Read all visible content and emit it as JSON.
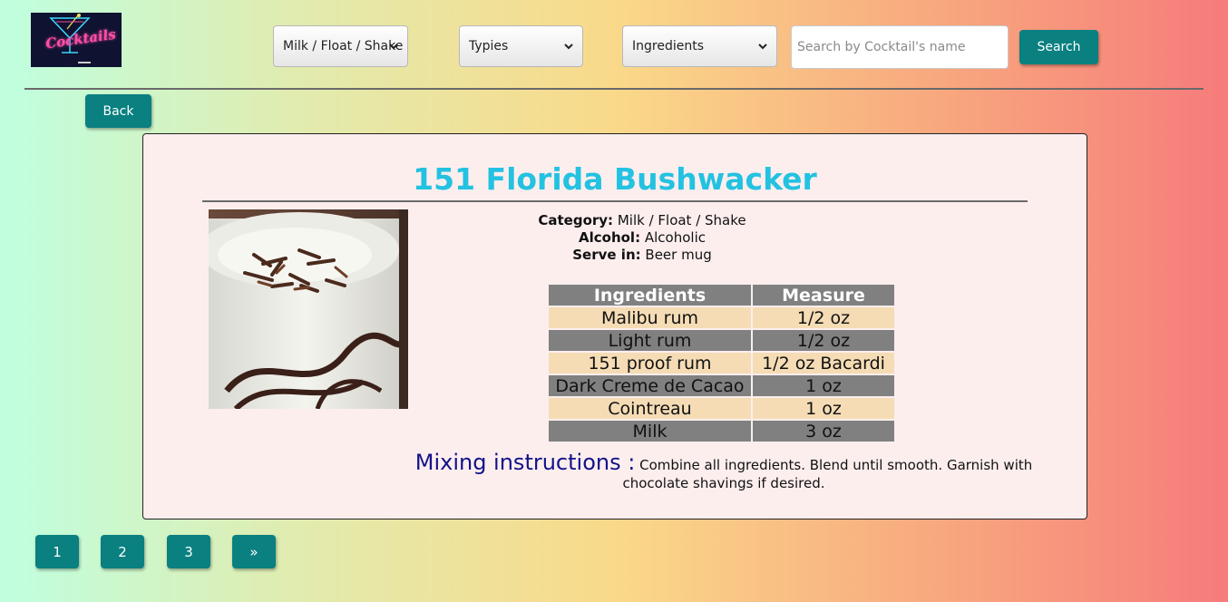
{
  "header": {
    "logo_text": "Cocktails",
    "category_select": {
      "selected": "Milk / Float / Shake"
    },
    "type_select": {
      "selected": "Typies"
    },
    "ingredient_select": {
      "selected": "Ingredients"
    },
    "search": {
      "placeholder": "Search by Cocktail's name",
      "value": "",
      "button_label": "Search"
    }
  },
  "back_label": "Back",
  "drink": {
    "name": "151 Florida Bushwacker",
    "category_label": "Category:",
    "category": "Milk / Float / Shake",
    "alcohol_label": "Alcohol:",
    "alcohol": "Alcoholic",
    "serve_label": "Serve in:",
    "serve": "Beer mug",
    "table_headers": [
      "Ingredients",
      "Measure"
    ],
    "ingredients": [
      {
        "name": "Malibu rum",
        "measure": "1/2 oz"
      },
      {
        "name": "Light rum",
        "measure": "1/2 oz"
      },
      {
        "name": "151 proof rum",
        "measure": "1/2 oz Bacardi"
      },
      {
        "name": "Dark Creme de Cacao",
        "measure": "1 oz"
      },
      {
        "name": "Cointreau",
        "measure": "1 oz"
      },
      {
        "name": "Milk",
        "measure": "3 oz"
      }
    ],
    "mix_label": "Mixing instructions :",
    "instructions": "Combine all ingredients. Blend until smooth. Garnish with chocolate shavings if desired."
  },
  "pagination": [
    "1",
    "2",
    "3",
    "»"
  ],
  "colors": {
    "accent_button": "#0a8080",
    "title": "#23c2e1",
    "card_background": "#fdeeee",
    "table_header": "#808080",
    "table_row_light": "#f5dcb5",
    "mix_label": "#12128a"
  }
}
